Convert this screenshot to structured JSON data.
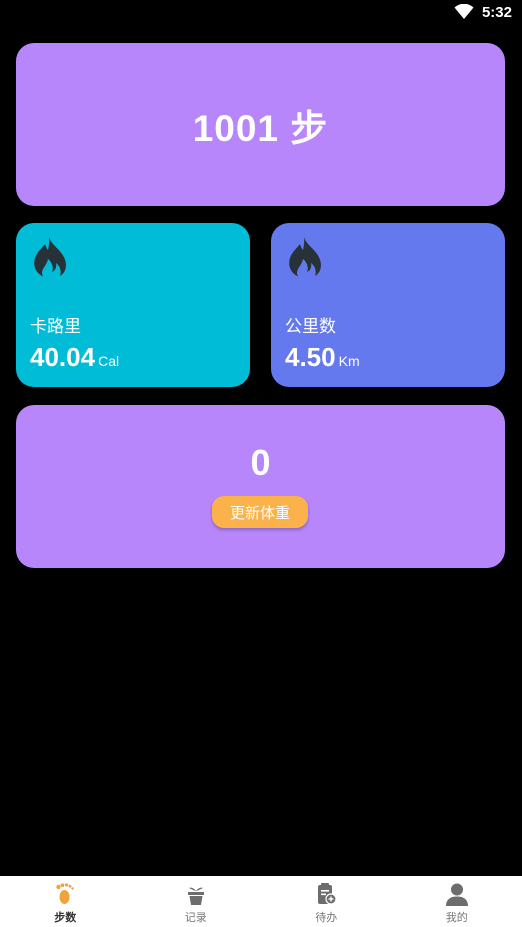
{
  "status_bar": {
    "time": "5:32"
  },
  "steps": {
    "value": "1001",
    "unit": "步"
  },
  "calories": {
    "label": "卡路里",
    "value": "40.04",
    "unit": "Cal"
  },
  "distance": {
    "label": "公里数",
    "value": "4.50",
    "unit": "Km"
  },
  "weight": {
    "value": "0",
    "button_label": "更新体重"
  },
  "bottom_nav": {
    "items": [
      {
        "label": "步数",
        "icon": "footprint-icon",
        "active": true
      },
      {
        "label": "记录",
        "icon": "plant-pot-icon",
        "active": false
      },
      {
        "label": "待办",
        "icon": "clipboard-add-icon",
        "active": false
      },
      {
        "label": "我的",
        "icon": "user-icon",
        "active": false
      }
    ]
  },
  "colors": {
    "steps_card": "#b886fb",
    "calories_card": "#00bcd6",
    "distance_card": "#6479ee",
    "weight_card": "#b886fb",
    "button": "#fbb24a",
    "active_nav_icon": "#f0a23b",
    "inactive_nav_icon": "#6d6d6d"
  }
}
